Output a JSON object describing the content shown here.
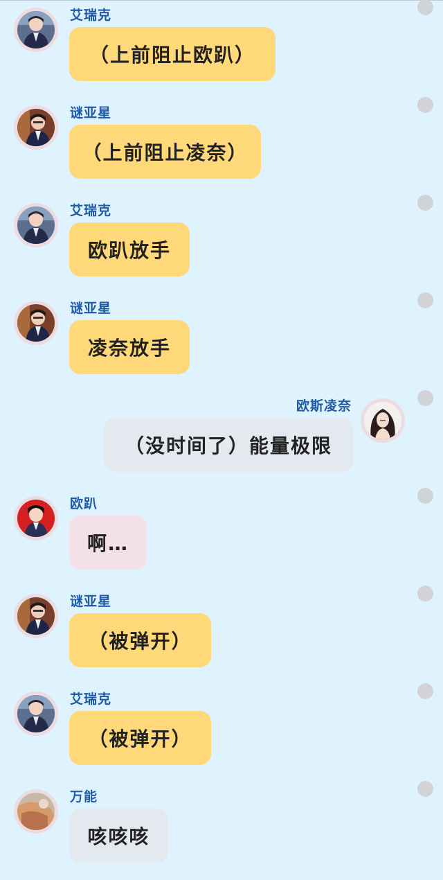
{
  "colors": {
    "background": "#dff3ff",
    "name_text": "#1f5aa3",
    "bubble_yellow": "#fed879",
    "bubble_gray": "#e4e8ef",
    "bubble_pink": "#f4e1e7",
    "status_dot": "#d1d3d6"
  },
  "messages": [
    {
      "side": "left",
      "avatar": "aric-avatar",
      "name": "艾瑞克",
      "text": "（上前阻止欧趴）",
      "bubble": "yellow",
      "width": 298
    },
    {
      "side": "left",
      "avatar": "mystar-avatar",
      "name": "谜亚星",
      "text": "（上前阻止凌奈）",
      "bubble": "yellow",
      "width": 277
    },
    {
      "side": "left",
      "avatar": "aric-avatar",
      "name": "艾瑞克",
      "text": "欧趴放手",
      "bubble": "yellow",
      "width": 174
    },
    {
      "side": "left",
      "avatar": "mystar-avatar",
      "name": "谜亚星",
      "text": "凌奈放手",
      "bubble": "yellow",
      "width": 174
    },
    {
      "side": "right",
      "avatar": "lingnai-avatar",
      "name": "欧斯凌奈",
      "text": "（没时间了）能量极限",
      "bubble": "gray",
      "width": 360
    },
    {
      "side": "left",
      "avatar": "opa-avatar",
      "name": "欧趴",
      "text": "啊…",
      "bubble": "pink",
      "width": 112
    },
    {
      "side": "left",
      "avatar": "mystar-avatar",
      "name": "谜亚星",
      "text": "（被弹开）",
      "bubble": "yellow",
      "width": 205
    },
    {
      "side": "left",
      "avatar": "aric-avatar",
      "name": "艾瑞克",
      "text": "（被弹开）",
      "bubble": "yellow",
      "width": 205
    },
    {
      "side": "left",
      "avatar": "wanneng-avatar",
      "name": "万能",
      "text": "咳咳咳",
      "bubble": "gray",
      "width": 143
    }
  ]
}
